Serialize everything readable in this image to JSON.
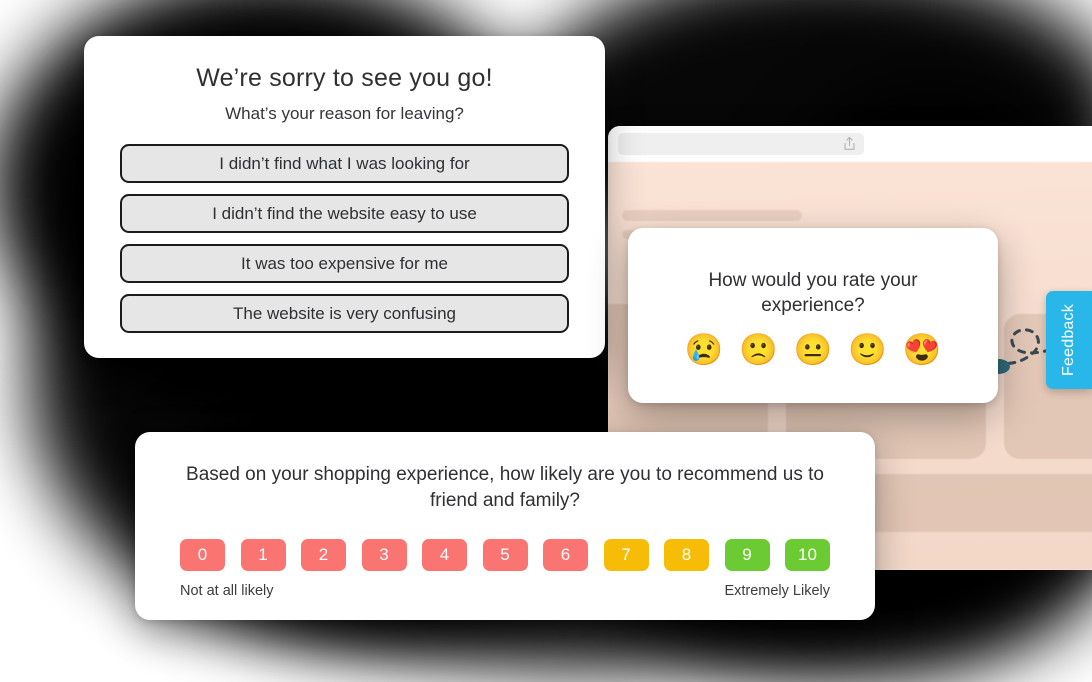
{
  "browser": {
    "address_bar_value": "",
    "share_icon": "share-upload-icon"
  },
  "feedback_tab": {
    "label": "Feedback",
    "color": "#29b6e8"
  },
  "cursor": {
    "color": "#2f6b7d"
  },
  "exit_card": {
    "title": "We’re sorry to see you go!",
    "subtitle": "What’s your reason for leaving?",
    "options": [
      "I didn’t find what I was looking for",
      "I didn’t find the website easy to use",
      "It was too expensive for me",
      "The website is very confusing"
    ]
  },
  "rating_card": {
    "title": "How would you rate your experience?",
    "emojis": [
      {
        "glyph": "😢",
        "name": "crying-face-emoji"
      },
      {
        "glyph": "🙁",
        "name": "frowning-face-emoji"
      },
      {
        "glyph": "😐",
        "name": "neutral-face-emoji"
      },
      {
        "glyph": "🙂",
        "name": "slightly-smiling-face-emoji"
      },
      {
        "glyph": "😍",
        "name": "heart-eyes-face-emoji"
      }
    ]
  },
  "nps_card": {
    "title": "Based on your shopping experience, how likely are you to recommend us to friend and family?",
    "low_label": "Not at all likely",
    "high_label": "Extremely Likely",
    "colors": {
      "detractor": "#fa7571",
      "passive": "#f7bc08",
      "promoter": "#6ccb33"
    },
    "scores": [
      {
        "value": "0",
        "color": "#fa7571"
      },
      {
        "value": "1",
        "color": "#fa7571"
      },
      {
        "value": "2",
        "color": "#fa7571"
      },
      {
        "value": "3",
        "color": "#fa7571"
      },
      {
        "value": "4",
        "color": "#fa7571"
      },
      {
        "value": "5",
        "color": "#fa7571"
      },
      {
        "value": "6",
        "color": "#fa7571"
      },
      {
        "value": "7",
        "color": "#f7bc08"
      },
      {
        "value": "8",
        "color": "#f7bc08"
      },
      {
        "value": "9",
        "color": "#6ccb33"
      },
      {
        "value": "10",
        "color": "#6ccb33"
      }
    ]
  }
}
